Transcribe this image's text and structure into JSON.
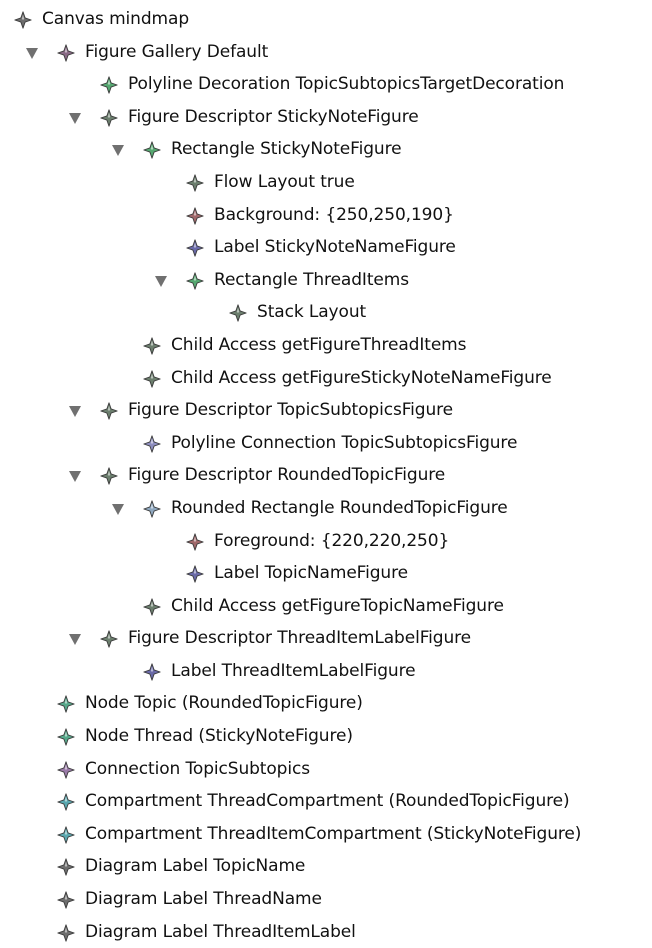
{
  "tree": {
    "nodes": [
      {
        "label": "Canvas mindmap",
        "depth": 0,
        "twisty": "none",
        "icon": "diamond-icon",
        "color": "#6e6e6e"
      },
      {
        "label": "Figure Gallery Default",
        "depth": 1,
        "twisty": "expanded",
        "icon": "diamond-icon",
        "color": "#8a6a86"
      },
      {
        "label": "Polyline Decoration TopicSubtopicsTargetDecoration",
        "depth": 2,
        "twisty": "none",
        "icon": "diamond-icon",
        "color": "#56a871"
      },
      {
        "label": "Figure Descriptor StickyNoteFigure",
        "depth": 2,
        "twisty": "expanded",
        "icon": "diamond-icon",
        "color": "#6c7f6e"
      },
      {
        "label": "Rectangle StickyNoteFigure",
        "depth": 3,
        "twisty": "expanded",
        "icon": "diamond-icon",
        "color": "#56a871"
      },
      {
        "label": "Flow Layout true",
        "depth": 4,
        "twisty": "none",
        "icon": "diamond-icon",
        "color": "#6c7f6e"
      },
      {
        "label": "Background: {250,250,190}",
        "depth": 4,
        "twisty": "none",
        "icon": "diamond-icon",
        "color": "#a0686a"
      },
      {
        "label": "Label StickyNoteNameFigure",
        "depth": 4,
        "twisty": "none",
        "icon": "diamond-icon",
        "color": "#6a6aa8"
      },
      {
        "label": "Rectangle ThreadItems",
        "depth": 4,
        "twisty": "expanded",
        "icon": "diamond-icon",
        "color": "#56a871"
      },
      {
        "label": "Stack Layout",
        "depth": 5,
        "twisty": "none",
        "icon": "diamond-icon",
        "color": "#6c7f6e"
      },
      {
        "label": "Child Access getFigureThreadItems",
        "depth": 3,
        "twisty": "none",
        "icon": "diamond-icon",
        "color": "#6c7f6e"
      },
      {
        "label": "Child Access getFigureStickyNoteNameFigure",
        "depth": 3,
        "twisty": "none",
        "icon": "diamond-icon",
        "color": "#6c7f6e"
      },
      {
        "label": "Figure Descriptor TopicSubtopicsFigure",
        "depth": 2,
        "twisty": "expanded",
        "icon": "diamond-icon",
        "color": "#6c7f6e"
      },
      {
        "label": "Polyline Connection TopicSubtopicsFigure",
        "depth": 3,
        "twisty": "none",
        "icon": "diamond-icon",
        "color": "#8f8fc0"
      },
      {
        "label": "Figure Descriptor RoundedTopicFigure",
        "depth": 2,
        "twisty": "expanded",
        "icon": "diamond-icon",
        "color": "#6c7f6e"
      },
      {
        "label": "Rounded Rectangle RoundedTopicFigure",
        "depth": 3,
        "twisty": "expanded",
        "icon": "diamond-icon",
        "color": "#8fa8c0"
      },
      {
        "label": "Foreground: {220,220,250}",
        "depth": 4,
        "twisty": "none",
        "icon": "diamond-icon",
        "color": "#a0686a"
      },
      {
        "label": "Label TopicNameFigure",
        "depth": 4,
        "twisty": "none",
        "icon": "diamond-icon",
        "color": "#6a6aa8"
      },
      {
        "label": "Child Access getFigureTopicNameFigure",
        "depth": 3,
        "twisty": "none",
        "icon": "diamond-icon",
        "color": "#6c7f6e"
      },
      {
        "label": "Figure Descriptor ThreadItemLabelFigure",
        "depth": 2,
        "twisty": "expanded",
        "icon": "diamond-icon",
        "color": "#6c7f6e"
      },
      {
        "label": "Label ThreadItemLabelFigure",
        "depth": 3,
        "twisty": "none",
        "icon": "diamond-icon",
        "color": "#6a6aa8"
      },
      {
        "label": "Node Topic (RoundedTopicFigure)",
        "depth": 1,
        "twisty": "none",
        "icon": "diamond-icon",
        "color": "#56a88a"
      },
      {
        "label": "Node Thread (StickyNoteFigure)",
        "depth": 1,
        "twisty": "none",
        "icon": "diamond-icon",
        "color": "#56a88a"
      },
      {
        "label": "Connection TopicSubtopics",
        "depth": 1,
        "twisty": "none",
        "icon": "diamond-icon",
        "color": "#9a7aa8"
      },
      {
        "label": "Compartment ThreadCompartment (RoundedTopicFigure)",
        "depth": 1,
        "twisty": "none",
        "icon": "diamond-icon",
        "color": "#5aa8b0"
      },
      {
        "label": "Compartment ThreadItemCompartment (StickyNoteFigure)",
        "depth": 1,
        "twisty": "none",
        "icon": "diamond-icon",
        "color": "#5aa8b0"
      },
      {
        "label": "Diagram Label TopicName",
        "depth": 1,
        "twisty": "none",
        "icon": "diamond-icon",
        "color": "#6e6e6e"
      },
      {
        "label": "Diagram Label ThreadName",
        "depth": 1,
        "twisty": "none",
        "icon": "diamond-icon",
        "color": "#6e6e6e"
      },
      {
        "label": "Diagram Label ThreadItemLabel",
        "depth": 1,
        "twisty": "none",
        "icon": "diamond-icon",
        "color": "#6e6e6e"
      }
    ]
  }
}
